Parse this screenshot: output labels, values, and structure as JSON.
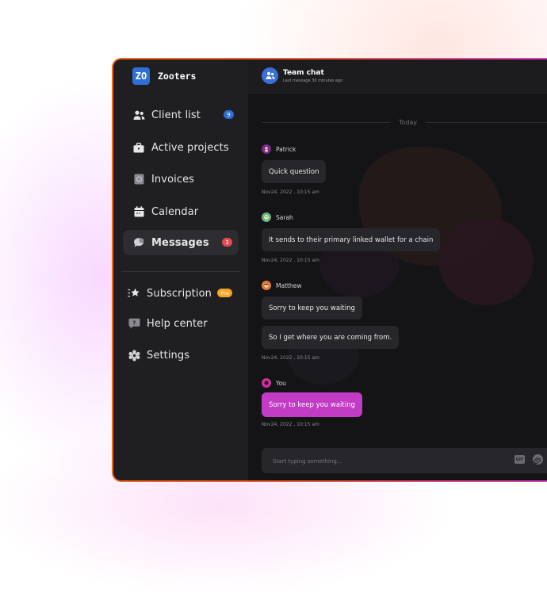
{
  "app": {
    "logo_text": "ZO",
    "name": "Zooters"
  },
  "sidebar": {
    "items": [
      {
        "label": "Client list",
        "icon": "users-icon",
        "badge": "9"
      },
      {
        "label": "Active projects",
        "icon": "briefcase-icon"
      },
      {
        "label": "Invoices",
        "icon": "invoice-icon"
      },
      {
        "label": "Calendar",
        "icon": "calendar-icon"
      },
      {
        "label": "Messages",
        "icon": "chat-icon",
        "badge": "3",
        "active": true
      }
    ],
    "secondary": [
      {
        "label": "Subscription",
        "icon": "star-list-icon",
        "badge": "Pro"
      },
      {
        "label": "Help center",
        "icon": "help-icon"
      },
      {
        "label": "Settings",
        "icon": "gear-icon"
      }
    ]
  },
  "chat": {
    "title": "Team chat",
    "subtitle": "Last message 30 minutes ago",
    "day_separator": "Today",
    "messages": [
      {
        "sender": "Patrick",
        "texts": [
          "Quick question"
        ],
        "time": "Nov24, 2022 , 10:15 am"
      },
      {
        "sender": "Sarah",
        "texts": [
          "It sends to their primary linked wallet for a chain"
        ],
        "time": "Nov24, 2022 , 10:15 am"
      },
      {
        "sender": "Matthew",
        "texts": [
          "Sorry to keep you waiting",
          "So I get where you are coming from."
        ],
        "time": "Nov24, 2022 , 10:15 am"
      },
      {
        "sender": "You",
        "texts": [
          "Sorry to keep you waiting"
        ],
        "time": "Nov24, 2022 , 10:15 am"
      }
    ],
    "composer": {
      "placeholder": "Start typing something...",
      "gif_label": "GIF"
    }
  },
  "colors": {
    "accent": "#c13bc4",
    "brand": "#2f6fd8",
    "frame_gradient_start": "#f2681f",
    "frame_gradient_end": "#d63fc9",
    "badge_red": "#e5484d",
    "badge_pro": "#f5a524"
  }
}
